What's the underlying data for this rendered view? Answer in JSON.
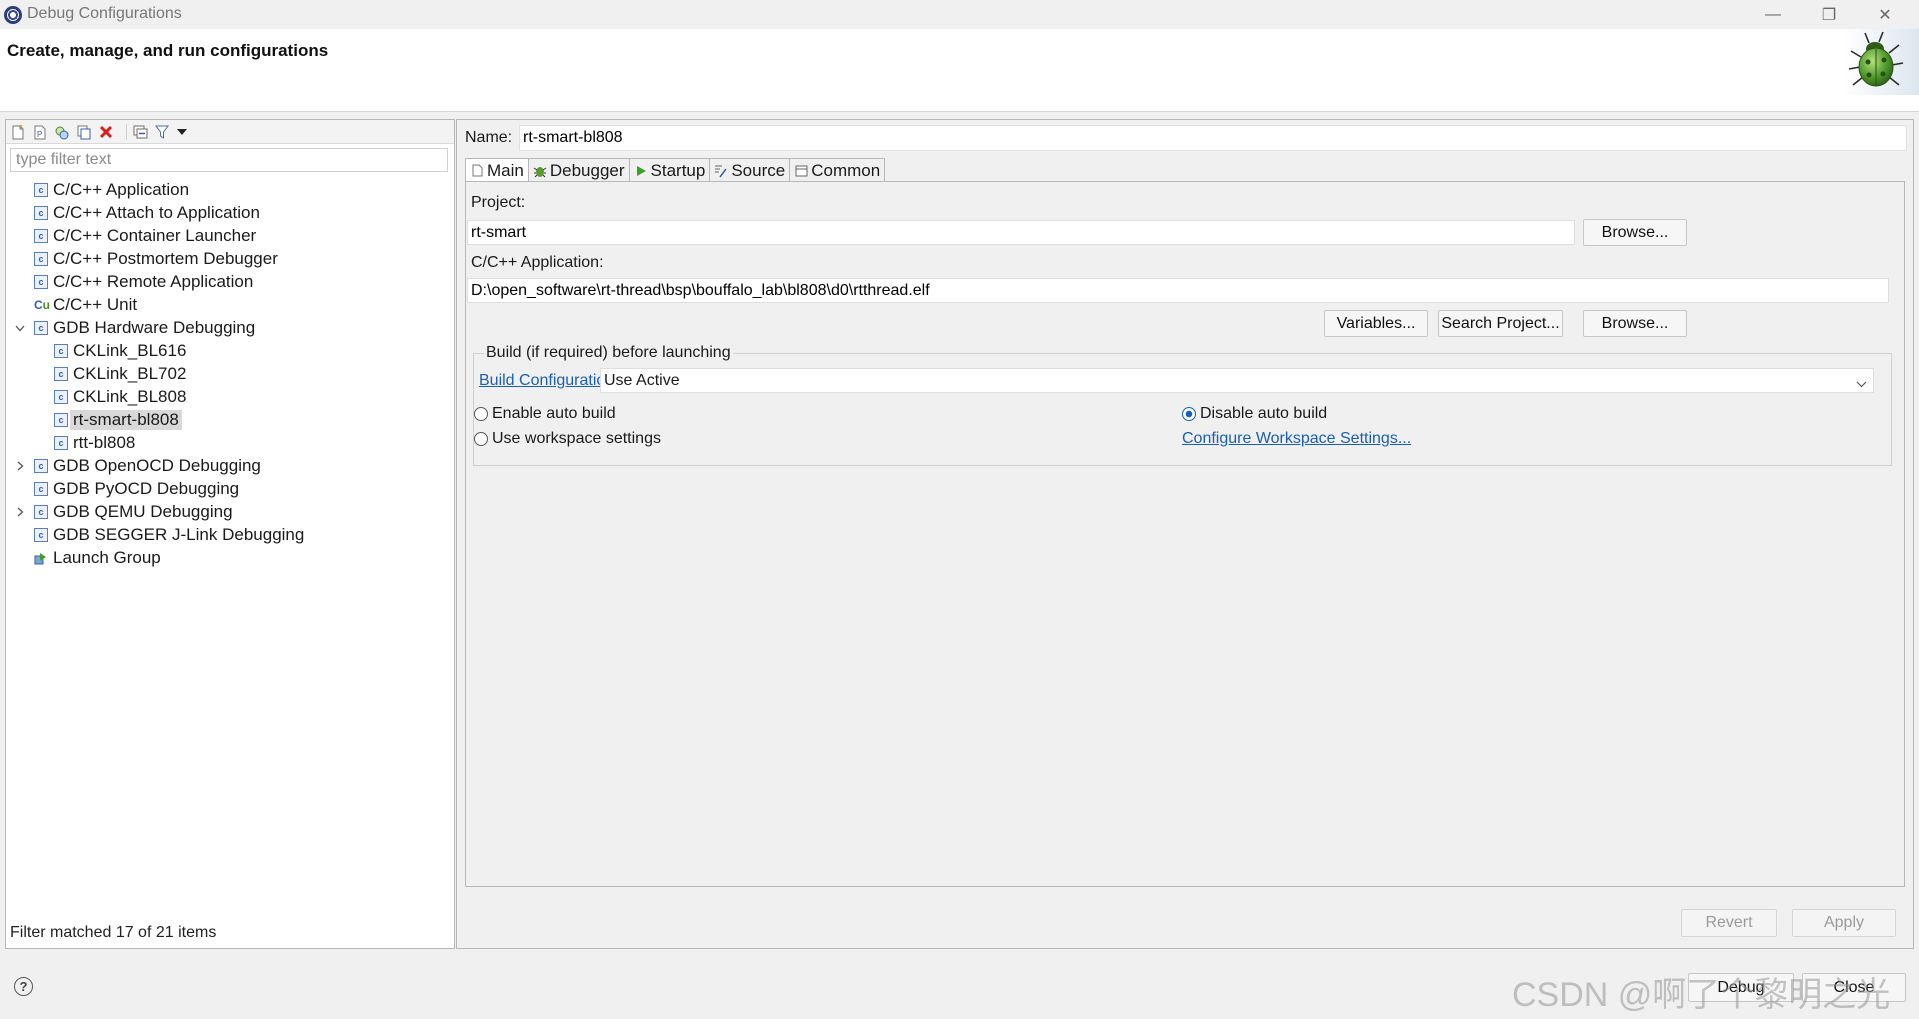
{
  "window": {
    "title": "Debug Configurations",
    "controls": {
      "minimize": "—",
      "restore": "❐",
      "close": "✕"
    }
  },
  "banner": {
    "title": "Create, manage, and run configurations",
    "icon": "bug-icon"
  },
  "left_panel": {
    "toolbar_icons": [
      "new-configuration-icon",
      "new-prototype-icon",
      "export-icon",
      "duplicate-icon",
      "delete-icon",
      "collapse-all-icon",
      "filter-icon",
      "view-menu-icon"
    ],
    "filter_placeholder": "type filter text",
    "tree": [
      {
        "label": "C/C++ Application",
        "level": 0,
        "icon": "c-config-icon"
      },
      {
        "label": "C/C++ Attach to Application",
        "level": 0,
        "icon": "c-config-icon"
      },
      {
        "label": "C/C++ Container Launcher",
        "level": 0,
        "icon": "c-config-icon"
      },
      {
        "label": "C/C++ Postmortem Debugger",
        "level": 0,
        "icon": "c-config-icon"
      },
      {
        "label": "C/C++ Remote Application",
        "level": 0,
        "icon": "c-config-icon"
      },
      {
        "label": "C/C++ Unit",
        "level": 0,
        "icon": "c-unit-icon"
      },
      {
        "label": "GDB Hardware Debugging",
        "level": 0,
        "icon": "c-config-icon",
        "expanded": true
      },
      {
        "label": "CKLink_BL616",
        "level": 1,
        "icon": "c-config-icon"
      },
      {
        "label": "CKLink_BL702",
        "level": 1,
        "icon": "c-config-icon"
      },
      {
        "label": "CKLink_BL808",
        "level": 1,
        "icon": "c-config-icon"
      },
      {
        "label": "rt-smart-bl808",
        "level": 1,
        "icon": "c-config-icon",
        "selected": true
      },
      {
        "label": "rtt-bl808",
        "level": 1,
        "icon": "c-config-icon"
      },
      {
        "label": "GDB OpenOCD Debugging",
        "level": 0,
        "icon": "c-config-icon",
        "collapsed": true
      },
      {
        "label": "GDB PyOCD Debugging",
        "level": 0,
        "icon": "c-config-icon"
      },
      {
        "label": "GDB QEMU Debugging",
        "level": 0,
        "icon": "c-config-icon",
        "collapsed": true
      },
      {
        "label": "GDB SEGGER J-Link Debugging",
        "level": 0,
        "icon": "c-config-icon"
      },
      {
        "label": "Launch Group",
        "level": 0,
        "icon": "launch-group-icon"
      }
    ],
    "filter_status": "Filter matched 17 of 21 items"
  },
  "right_panel": {
    "name_label": "Name:",
    "name_value": "rt-smart-bl808",
    "tabs": [
      {
        "label": "Main",
        "icon": "main-tab-icon",
        "active": true
      },
      {
        "label": "Debugger",
        "icon": "debugger-tab-icon"
      },
      {
        "label": "Startup",
        "icon": "startup-tab-icon"
      },
      {
        "label": "Source",
        "icon": "source-tab-icon"
      },
      {
        "label": "Common",
        "icon": "common-tab-icon"
      }
    ],
    "main": {
      "project_label": "Project:",
      "project_value": "rt-smart",
      "project_browse": "Browse...",
      "app_label": "C/C++ Application:",
      "app_value": "D:\\open_software\\rt-thread\\bsp\\bouffalo_lab\\bl808\\d0\\rtthread.elf",
      "variables_button": "Variables...",
      "search_project_button": "Search Project...",
      "app_browse": "Browse...",
      "build_group_title": "Build (if required) before launching",
      "build_config_link": "Build Configuration:",
      "build_config_value": "Use Active",
      "enable_auto_build": "Enable auto build",
      "disable_auto_build": "Disable auto build",
      "use_workspace_settings": "Use workspace settings",
      "configure_workspace_link": "Configure Workspace Settings...",
      "selected_build_option": "Disable auto build"
    },
    "revert_button": "Revert",
    "apply_button": "Apply"
  },
  "footer": {
    "help_icon": "help-icon",
    "debug_button": "Debug",
    "close_button": "Close",
    "watermark": "CSDN @啊了个黎明之光"
  }
}
